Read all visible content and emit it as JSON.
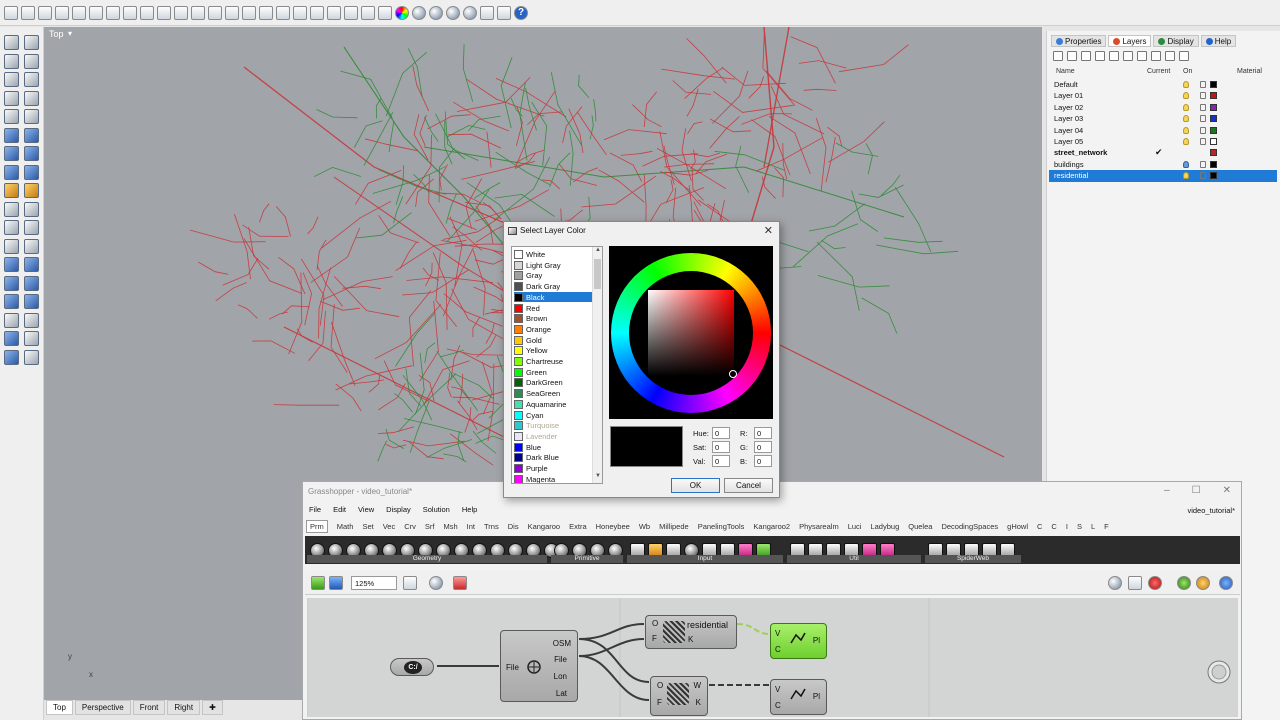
{
  "viewport": {
    "label": "Top",
    "arrow": "▾",
    "axis_y": "y",
    "axis_x": "x",
    "tabs": [
      "Top",
      "Perspective",
      "Front",
      "Right",
      "✚"
    ]
  },
  "panel": {
    "tabs": [
      {
        "label": "Properties",
        "color": "#3b7bd4"
      },
      {
        "label": "Layers",
        "color": "#e04a2a"
      },
      {
        "label": "Display",
        "color": "#2d8a3e"
      },
      {
        "label": "Help",
        "color": "#2563c9"
      }
    ],
    "columns": {
      "name": "Name",
      "current": "Current",
      "on": "On",
      "material": "Material"
    },
    "layers": [
      {
        "name": "Default",
        "current": "",
        "color": "#000000"
      },
      {
        "name": "Layer 01",
        "current": "",
        "color": "#cc1111"
      },
      {
        "name": "Layer 02",
        "current": "",
        "color": "#8e22b8"
      },
      {
        "name": "Layer 03",
        "current": "",
        "color": "#1531c8"
      },
      {
        "name": "Layer 04",
        "current": "",
        "color": "#1a7a1a"
      },
      {
        "name": "Layer 05",
        "current": "",
        "color": "#ffffff"
      },
      {
        "name": "street_network",
        "current": "✔",
        "color": "#b8262b"
      },
      {
        "name": "buildings",
        "current": "",
        "color": "#000000"
      },
      {
        "name": "residential",
        "current": "",
        "color": "#000000"
      }
    ]
  },
  "dialog": {
    "title": "Select Layer Color",
    "close": "✕",
    "colors": [
      {
        "name": "White",
        "swatch": "#ffffff"
      },
      {
        "name": "Light Gray",
        "swatch": "#d6d6d6"
      },
      {
        "name": "Gray",
        "swatch": "#a0a0a0"
      },
      {
        "name": "Dark Gray",
        "swatch": "#505050"
      },
      {
        "name": "Black",
        "swatch": "#000000"
      },
      {
        "name": "Red",
        "swatch": "#ff0000"
      },
      {
        "name": "Brown",
        "swatch": "#a0522d"
      },
      {
        "name": "Orange",
        "swatch": "#ff8000"
      },
      {
        "name": "Gold",
        "swatch": "#ffc800"
      },
      {
        "name": "Yellow",
        "swatch": "#ffff00"
      },
      {
        "name": "Chartreuse",
        "swatch": "#80ff00"
      },
      {
        "name": "Green",
        "swatch": "#00ff00"
      },
      {
        "name": "DarkGreen",
        "swatch": "#006400"
      },
      {
        "name": "SeaGreen",
        "swatch": "#2e8b57"
      },
      {
        "name": "Aquamarine",
        "swatch": "#40e0b0"
      },
      {
        "name": "Cyan",
        "swatch": "#00ffff"
      },
      {
        "name": "Turquoise",
        "swatch": "#30c8c8"
      },
      {
        "name": "Lavender",
        "swatch": "#e6e6fa"
      },
      {
        "name": "Blue",
        "swatch": "#0000ff"
      },
      {
        "name": "Dark Blue",
        "swatch": "#00008b"
      },
      {
        "name": "Purple",
        "swatch": "#9400d3"
      },
      {
        "name": "Magenta",
        "swatch": "#ff00ff"
      }
    ],
    "selected": "Black",
    "fields": {
      "hue_label": "Hue:",
      "hue": "0",
      "sat_label": "Sat:",
      "sat": "0",
      "val_label": "Val:",
      "val": "0",
      "r_label": "R:",
      "r": "0",
      "g_label": "G:",
      "g": "0",
      "b_label": "B:",
      "b": "0"
    },
    "ok": "OK",
    "cancel": "Cancel"
  },
  "grasshopper": {
    "title": "Grasshopper - video_tutorial*",
    "document": "video_tutorial*",
    "window_controls": [
      "–",
      "☐",
      "✕"
    ],
    "menu": [
      "File",
      "Edit",
      "View",
      "Display",
      "Solution",
      "Help"
    ],
    "tabs": [
      "Prm",
      "Math",
      "Set",
      "Vec",
      "Crv",
      "Srf",
      "Msh",
      "Int",
      "Trns",
      "Dis",
      "Kangaroo",
      "Extra",
      "Honeybee",
      "Wb",
      "Millipede",
      "PanelingTools",
      "Kangaroo2",
      "Physarealm",
      "Luci",
      "Ladybug",
      "Queleа",
      "DecodingSpaces",
      "gHowl",
      "C",
      "C",
      "I",
      "S",
      "L",
      "F"
    ],
    "groups": [
      "Geometry",
      "Primitive",
      "Input",
      "Util",
      "SpiderWeb"
    ],
    "zoom": "125%",
    "components": {
      "file_path": "C:/",
      "osm_in": "File",
      "osm_out": [
        "OSM",
        "File",
        "Lon",
        "Lat"
      ],
      "filter1_in": [
        "O",
        "F"
      ],
      "filter1_label": "residential",
      "filter1_out": "K",
      "filter2_in": [
        "O",
        "F"
      ],
      "filter2_out": [
        "W",
        "K"
      ],
      "pl1_in": [
        "V",
        "C"
      ],
      "pl1_out": "Pl",
      "pl2_in": [
        "V",
        "C"
      ],
      "pl2_out": "Pl"
    }
  },
  "colors": {
    "street_red": "#c8353a",
    "street_green": "#2f8a36",
    "selection": "#1f7bd6",
    "gh_toolbar": "#2b2b2b"
  }
}
